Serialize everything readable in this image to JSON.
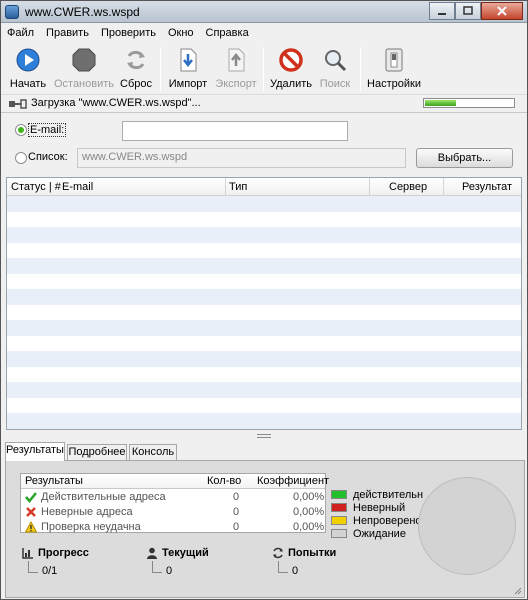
{
  "window": {
    "title": "www.CWER.ws.wspd"
  },
  "menu": [
    "Файл",
    "Править",
    "Проверить",
    "Окно",
    "Справка"
  ],
  "toolbar": {
    "start": "Начать",
    "stop": "Остановить",
    "reset": "Сброс",
    "import": "Импорт",
    "export": "Экспорт",
    "delete": "Удалить",
    "search": "Поиск",
    "settings": "Настройки"
  },
  "status": {
    "text": "Загрузка \"www.CWER.ws.wspd\"...",
    "progress": 0.35
  },
  "form": {
    "email_label": "E-mail:",
    "email_value": "",
    "list_label": "Список:",
    "list_value": "www.CWER.ws.wspd",
    "choose_button": "Выбрать..."
  },
  "grid": {
    "columns": [
      "Статус | #",
      "E-mail",
      "Тип",
      "Сервер",
      "Результат"
    ],
    "row_count": 15
  },
  "tabs": [
    "Результаты",
    "Подробнее",
    "Консоль"
  ],
  "results": {
    "headers": [
      "Результаты",
      "Кол-во",
      "Коэффициент"
    ],
    "rows": [
      {
        "label": "Действительные адреса",
        "count": "0",
        "ratio": "0,00%",
        "icon": "check-icon"
      },
      {
        "label": "Неверные адреса",
        "count": "0",
        "ratio": "0,00%",
        "icon": "cross-icon"
      },
      {
        "label": "Проверка неудачна",
        "count": "0",
        "ratio": "0,00%",
        "icon": "warning-icon"
      }
    ]
  },
  "legend": [
    {
      "label": "действительн",
      "color": "#22c02a"
    },
    {
      "label": "Неверный",
      "color": "#d02020"
    },
    {
      "label": "Непроверено",
      "color": "#f0d000"
    },
    {
      "label": "Ожидание",
      "color": "#d3d3d3"
    }
  ],
  "stats": {
    "progress_label": "Прогресс",
    "progress_value": "0/1",
    "current_label": "Текущий",
    "current_value": "0",
    "attempts_label": "Попытки",
    "attempts_value": "0"
  }
}
